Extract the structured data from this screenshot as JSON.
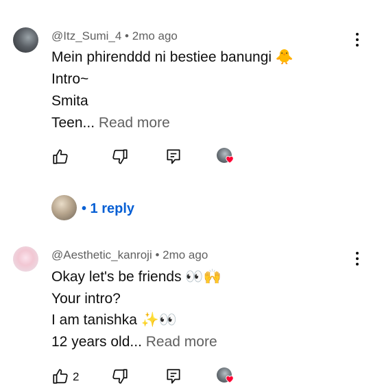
{
  "comments": [
    {
      "author": "@Itz_Sumi_4",
      "time": "2mo ago",
      "lines": [
        "Mein phirenddd ni bestiee banungi 🐥",
        "Intro~",
        "Smita"
      ],
      "last_line": "Teen...",
      "read_more": "Read more",
      "like_count": "",
      "reply_label": "• 1 reply"
    },
    {
      "author": "@Aesthetic_kanroji",
      "time": "2mo ago",
      "lines": [
        "Okay let's be friends 👀🙌",
        "Your intro?",
        "I am tanishka ✨👀"
      ],
      "last_line": "12 years old...",
      "read_more": "Read more",
      "like_count": "2"
    }
  ],
  "separator": "•"
}
